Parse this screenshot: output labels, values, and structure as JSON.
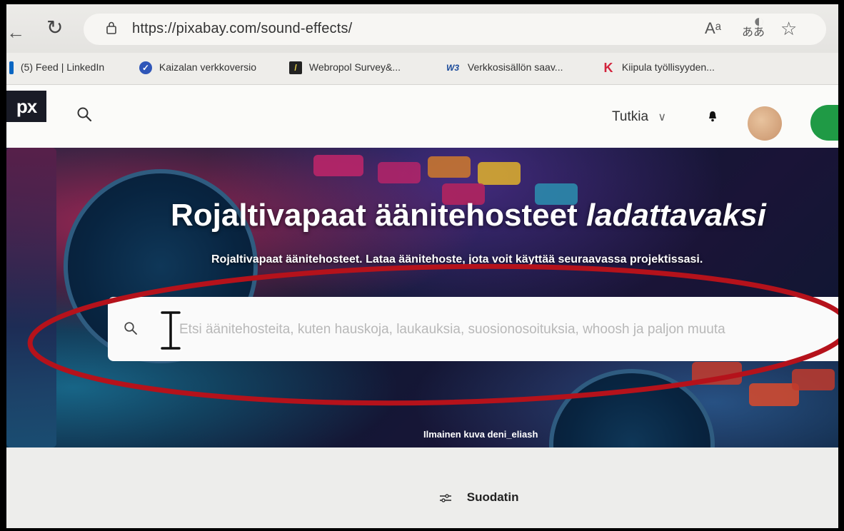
{
  "browser": {
    "url": "https://pixabay.com/sound-effects/",
    "read_aloud_label": "Aᵃ",
    "translate_label": "ああ",
    "bookmarks": [
      {
        "label": "(5) Feed | LinkedIn",
        "icon": "linkedin-icon"
      },
      {
        "label": "Kaizalan verkkoversio",
        "icon": "kaizala-icon"
      },
      {
        "label": "Webropol Survey&...",
        "icon": "webropol-icon"
      },
      {
        "label": "Verkkosisällön saav...",
        "icon": "w3-icon",
        "icon_text": "W3"
      },
      {
        "label": "Kiipula työllisyyden...",
        "icon": "kiipula-icon",
        "icon_text": "K"
      }
    ]
  },
  "header": {
    "logo": "px",
    "explore_label": "Tutkia",
    "colors": {
      "join_button": "#1f9a45",
      "logo_bg": "#191b26"
    }
  },
  "hero": {
    "title_main": "Rojaltivapaat äänitehosteet ",
    "title_italic": "ladattavaksi",
    "subtitle": "Rojaltivapaat äänitehosteet. Lataa äänitehoste, jota voit käyttää seuraavassa projektissasi.",
    "search_placeholder": "Etsi äänitehosteita, kuten hauskoja, laukauksia, suosionosoituksia, whoosh ja paljon muuta",
    "photo_credit": "Ilmainen kuva deni_eliash",
    "annotation_color": "#b5121b"
  },
  "filter": {
    "label": "Suodatin"
  }
}
